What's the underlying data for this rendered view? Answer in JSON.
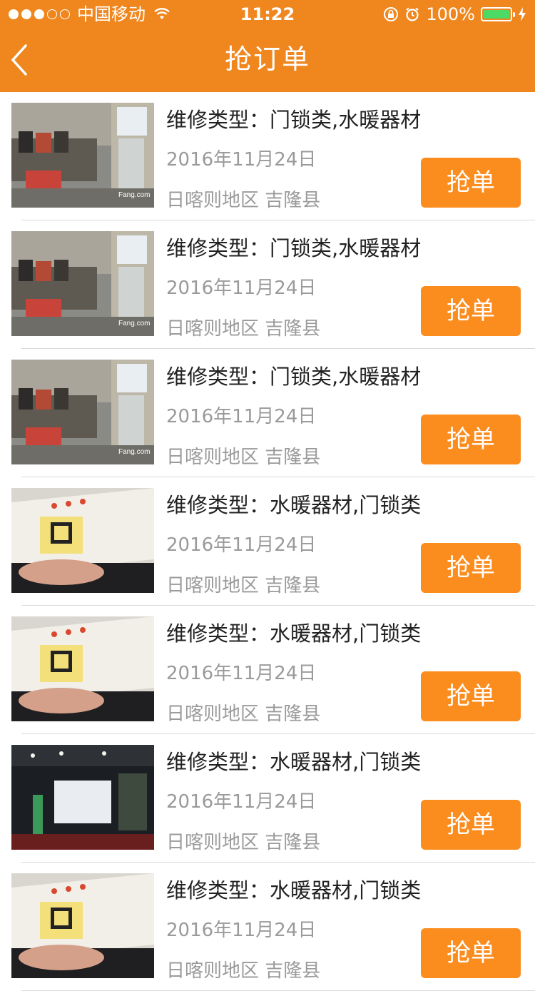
{
  "status_bar": {
    "carrier": "中国移动",
    "time": "11:22",
    "battery": "100%"
  },
  "nav": {
    "title": "抢订单"
  },
  "orders": [
    {
      "title": "维修类型：门锁类,水暖器材",
      "date": "2016年11月24日",
      "region": "日喀则地区 吉隆县",
      "action": "抢单",
      "image": "room"
    },
    {
      "title": "维修类型：门锁类,水暖器材",
      "date": "2016年11月24日",
      "region": "日喀则地区 吉隆县",
      "action": "抢单",
      "image": "room"
    },
    {
      "title": "维修类型：门锁类,水暖器材",
      "date": "2016年11月24日",
      "region": "日喀则地区 吉隆县",
      "action": "抢单",
      "image": "room"
    },
    {
      "title": "维修类型：水暖器材,门锁类",
      "date": "2016年11月24日",
      "region": "日喀则地区 吉隆县",
      "action": "抢单",
      "image": "paper"
    },
    {
      "title": "维修类型：水暖器材,门锁类",
      "date": "2016年11月24日",
      "region": "日喀则地区 吉隆县",
      "action": "抢单",
      "image": "paper"
    },
    {
      "title": "维修类型：水暖器材,门锁类",
      "date": "2016年11月24日",
      "region": "日喀则地区 吉隆县",
      "action": "抢单",
      "image": "hall"
    },
    {
      "title": "维修类型：水暖器材,门锁类",
      "date": "2016年11月24日",
      "region": "日喀则地区 吉隆县",
      "action": "抢单",
      "image": "paper"
    }
  ],
  "colors": {
    "header": "#F0861E",
    "button": "#FB8C1E",
    "battery": "#4CD964"
  }
}
